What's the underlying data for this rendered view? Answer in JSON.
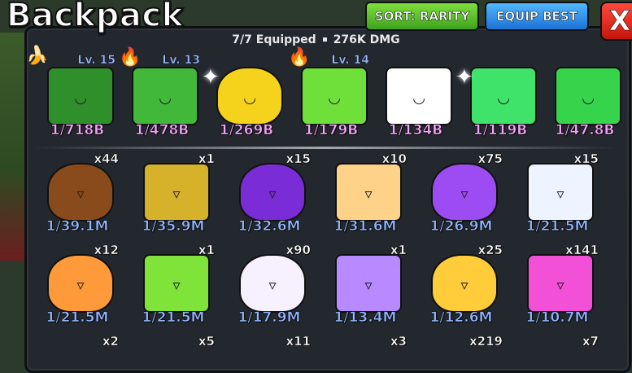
{
  "window": {
    "title": "Backpack",
    "sort_label": "SORT: RARITY",
    "equip_label": "EQUIP BEST",
    "close_label": "X"
  },
  "summary": {
    "equipped": "7/7 Equipped",
    "damage": "276K DMG"
  },
  "equipped_pets": [
    {
      "ratio": "1/718B",
      "level": "Lv. 15",
      "color": "#2f8f2a"
    },
    {
      "ratio": "1/478B",
      "level": "Lv. 13",
      "color": "#41b83a"
    },
    {
      "ratio": "1/269B",
      "level": "",
      "color": "#f5d21c"
    },
    {
      "ratio": "1/179B",
      "level": "Lv. 14",
      "color": "#6fe03a"
    },
    {
      "ratio": "1/134B",
      "level": "",
      "color": "#ffffff"
    },
    {
      "ratio": "1/119B",
      "level": "",
      "color": "#3fe36a"
    },
    {
      "ratio": "1/47.8B",
      "level": "",
      "color": "#36d44b"
    }
  ],
  "inventory_row1": [
    {
      "ratio": "1/39.1M",
      "count": "x44",
      "color": "#8a4b1c"
    },
    {
      "ratio": "1/35.9M",
      "count": "x1",
      "color": "#d6b12a"
    },
    {
      "ratio": "1/32.6M",
      "count": "x15",
      "color": "#7a2cd6"
    },
    {
      "ratio": "1/31.6M",
      "count": "x10",
      "color": "#ffd28a"
    },
    {
      "ratio": "1/26.9M",
      "count": "x75",
      "color": "#9c4cf2"
    },
    {
      "ratio": "1/21.5M",
      "count": "x15",
      "color": "#eef4ff"
    }
  ],
  "inventory_row2": [
    {
      "ratio": "1/21.5M",
      "count": "x12",
      "color": "#ff9a3a"
    },
    {
      "ratio": "1/21.5M",
      "count": "x1",
      "color": "#7fe33a"
    },
    {
      "ratio": "1/17.9M",
      "count": "x90",
      "color": "#f7f0ff"
    },
    {
      "ratio": "1/13.4M",
      "count": "x1",
      "color": "#b78aff"
    },
    {
      "ratio": "1/12.6M",
      "count": "x25",
      "color": "#ffcc3a"
    },
    {
      "ratio": "1/10.7M",
      "count": "x141",
      "color": "#f250d6"
    }
  ],
  "inventory_row3_counts": [
    "x2",
    "x5",
    "x11",
    "x3",
    "x219",
    "x7"
  ]
}
